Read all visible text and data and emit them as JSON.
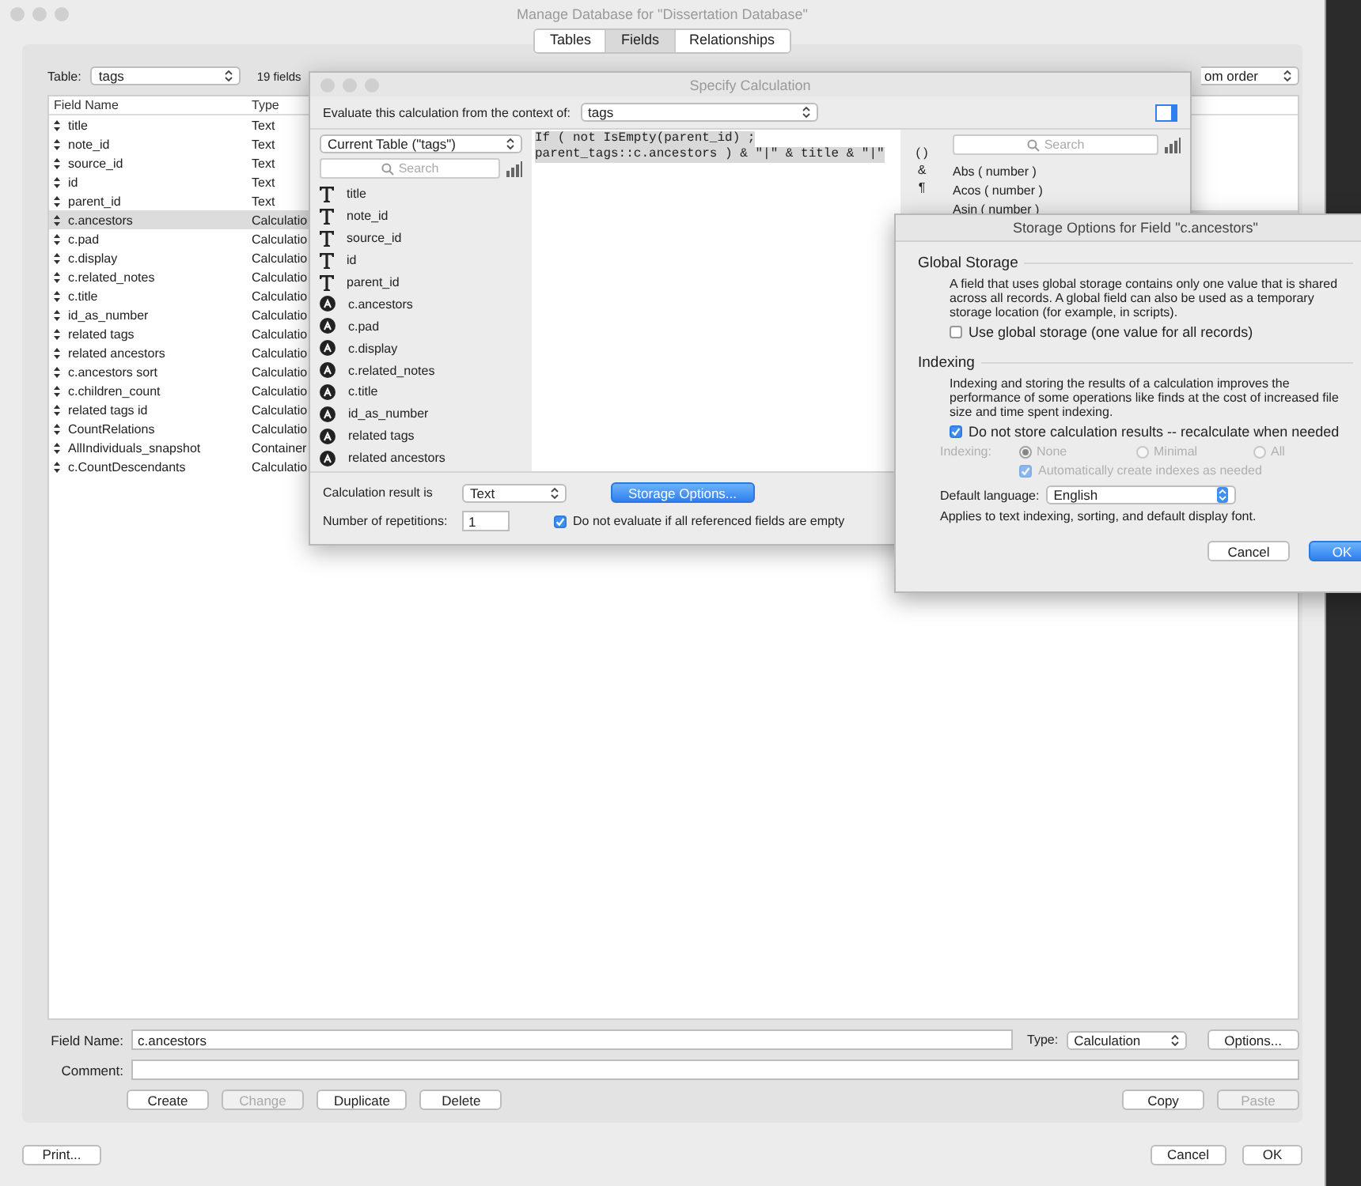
{
  "main_window": {
    "title": "Manage Database for \"Dissertation Database\"",
    "tabs": [
      {
        "label": "Tables",
        "selected": false
      },
      {
        "label": "Fields",
        "selected": true
      },
      {
        "label": "Relationships",
        "selected": false
      }
    ],
    "table_label": "Table:",
    "table_value": "tags",
    "field_count": "19 fields",
    "view_value": "om order",
    "field_list": {
      "columns": [
        "Field Name",
        "Type"
      ],
      "rows": [
        {
          "name": "title",
          "type": "Text",
          "selected": false
        },
        {
          "name": "note_id",
          "type": "Text",
          "selected": false
        },
        {
          "name": "source_id",
          "type": "Text",
          "selected": false
        },
        {
          "name": "id",
          "type": "Text",
          "selected": false
        },
        {
          "name": "parent_id",
          "type": "Text",
          "selected": false
        },
        {
          "name": "c.ancestors",
          "type": "Calculatio",
          "selected": true
        },
        {
          "name": "c.pad",
          "type": "Calculatio",
          "selected": false
        },
        {
          "name": "c.display",
          "type": "Calculatio",
          "selected": false
        },
        {
          "name": "c.related_notes",
          "type": "Calculatio",
          "selected": false
        },
        {
          "name": "c.title",
          "type": "Calculatio",
          "selected": false
        },
        {
          "name": "id_as_number",
          "type": "Calculatio",
          "selected": false
        },
        {
          "name": "related tags",
          "type": "Calculatio",
          "selected": false
        },
        {
          "name": "related ancestors",
          "type": "Calculatio",
          "selected": false
        },
        {
          "name": "c.ancestors sort",
          "type": "Calculatio",
          "selected": false
        },
        {
          "name": "c.children_count",
          "type": "Calculatio",
          "selected": false
        },
        {
          "name": "related tags id",
          "type": "Calculatio",
          "selected": false
        },
        {
          "name": "CountRelations",
          "type": "Calculatio",
          "selected": false
        },
        {
          "name": "AllIndividuals_snapshot",
          "type": "Container",
          "selected": false
        },
        {
          "name": "c.CountDescendants",
          "type": "Calculatio",
          "selected": false
        }
      ]
    },
    "field_name_label": "Field Name:",
    "field_name_value": "c.ancestors",
    "type_label": "Type:",
    "type_value": "Calculation",
    "options_button": "Options...",
    "comment_label": "Comment:",
    "edit_buttons": [
      {
        "label": "Create",
        "disabled": false
      },
      {
        "label": "Change",
        "disabled": true
      },
      {
        "label": "Duplicate",
        "disabled": false
      },
      {
        "label": "Delete",
        "disabled": false
      }
    ],
    "clip_buttons": [
      {
        "label": "Copy",
        "disabled": false
      },
      {
        "label": "Paste",
        "disabled": true
      }
    ],
    "print_button": "Print...",
    "footer_buttons": [
      "Cancel",
      "OK"
    ]
  },
  "calc_window": {
    "title": "Specify Calculation",
    "context_label": "Evaluate this calculation from the context of:",
    "context_value": "tags",
    "table_menu": "Current Table (\"tags\")",
    "search_placeholder": "Search",
    "fields": [
      {
        "name": "title",
        "kind": "text"
      },
      {
        "name": "note_id",
        "kind": "text"
      },
      {
        "name": "source_id",
        "kind": "text"
      },
      {
        "name": "id",
        "kind": "text"
      },
      {
        "name": "parent_id",
        "kind": "text"
      },
      {
        "name": "c.ancestors",
        "kind": "calc"
      },
      {
        "name": "c.pad",
        "kind": "calc"
      },
      {
        "name": "c.display",
        "kind": "calc"
      },
      {
        "name": "c.related_notes",
        "kind": "calc"
      },
      {
        "name": "c.title",
        "kind": "calc"
      },
      {
        "name": "id_as_number",
        "kind": "calc"
      },
      {
        "name": "related tags",
        "kind": "calc"
      },
      {
        "name": "related ancestors",
        "kind": "calc"
      }
    ],
    "formula": [
      "If ( not IsEmpty(parent_id) ;",
      "parent_tags::c.ancestors ) & \"|\" & title & \"|\""
    ],
    "operators": [
      "( )",
      "&",
      "¶"
    ],
    "function_search_placeholder": "Search",
    "functions": [
      "Abs ( number )",
      "Acos ( number )",
      "Asin ( number )"
    ],
    "result_label": "Calculation result is",
    "result_value": "Text",
    "storage_button": "Storage Options...",
    "repetitions_label": "Number of repetitions:",
    "repetitions_value": "1",
    "skip_empty": {
      "label": "Do not evaluate if all referenced fields are empty",
      "checked": true
    }
  },
  "storage_window": {
    "title": "Storage Options for Field \"c.ancestors\"",
    "global_heading": "Global Storage",
    "global_text": "A field that uses global storage contains only one value that is shared across all records.  A global field can also be used as a temporary storage location (for example, in scripts).",
    "global_checkbox": {
      "label": "Use global storage (one value for all records)",
      "checked": false
    },
    "indexing_heading": "Indexing",
    "indexing_text": "Indexing and storing the results of a calculation improves the performance of some operations like finds at the cost of increased file size and time spent indexing.",
    "no_store_checkbox": {
      "label": "Do not store calculation results -- recalculate when needed",
      "checked": true
    },
    "indexing_label": "Indexing:",
    "indexing_disabled": true,
    "indexing_options": [
      {
        "label": "None",
        "selected": true
      },
      {
        "label": "Minimal",
        "selected": false
      },
      {
        "label": "All",
        "selected": false
      }
    ],
    "auto_index": {
      "label": "Automatically create indexes as needed",
      "checked": true
    },
    "language_label": "Default language:",
    "language_value": "English",
    "language_note": "Applies to text indexing, sorting, and default display font.",
    "buttons": [
      {
        "label": "Cancel",
        "default": false
      },
      {
        "label": "OK",
        "default": true
      }
    ]
  }
}
